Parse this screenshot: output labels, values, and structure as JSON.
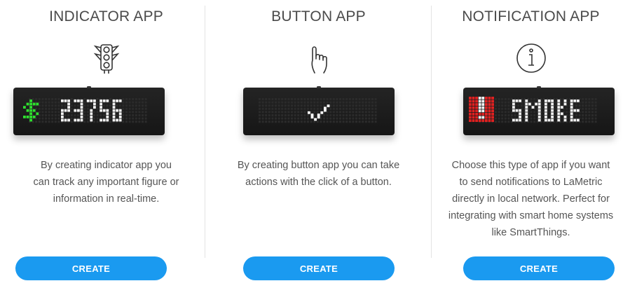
{
  "cards": [
    {
      "title": "INDICATOR APP",
      "icon": "traffic-light-icon",
      "display": {
        "glyph": "dollar",
        "glyph_color": "#2ee02e",
        "text": "23756"
      },
      "description": [
        "By creating indicator app you",
        "can track any important figure or",
        "information in real-time."
      ],
      "button": "CREATE"
    },
    {
      "title": "BUTTON APP",
      "icon": "pointing-hand-icon",
      "display": {
        "glyph": "checkmark",
        "glyph_color": "#ffffff",
        "text": ""
      },
      "description": [
        "By creating button app you can take",
        "actions with the click of a button."
      ],
      "button": "CREATE"
    },
    {
      "title": "NOTIFICATION APP",
      "icon": "info-circle-icon",
      "display": {
        "glyph": "exclamation",
        "glyph_color": "#e02020",
        "text": "SMOKE"
      },
      "description": [
        "Choose this type of app if you want",
        "to send notifications to LaMetric",
        "directly in local network. Perfect for",
        "integrating with smart home systems",
        "like SmartThings."
      ],
      "button": "CREATE"
    }
  ],
  "colors": {
    "accent": "#1a9af0",
    "pixel_on": "#f2f2f2",
    "pixel_off": "#2b2b2b"
  }
}
